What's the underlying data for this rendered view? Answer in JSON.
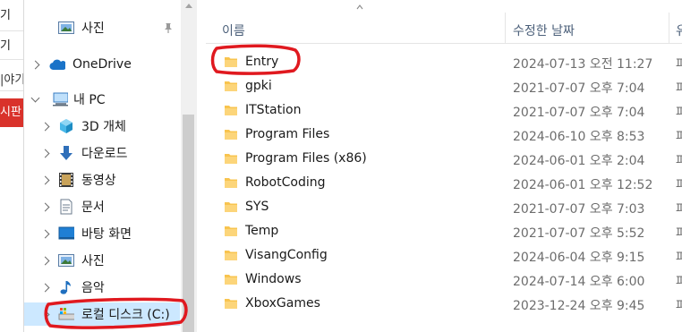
{
  "background_window": {
    "fragments": [
      "기",
      "기",
      "|야기"
    ],
    "red_bar_text": "시판"
  },
  "nav": {
    "items": [
      {
        "label": "사진",
        "icon": "pictures-icon",
        "pinned": true
      },
      {
        "label": "OneDrive",
        "icon": "onedrive-cloud-icon"
      },
      {
        "label": "내 PC",
        "icon": "this-pc-icon"
      },
      {
        "label": "3D 개체",
        "icon": "3d-objects-icon"
      },
      {
        "label": "다운로드",
        "icon": "downloads-icon"
      },
      {
        "label": "동영상",
        "icon": "videos-icon"
      },
      {
        "label": "문서",
        "icon": "documents-icon"
      },
      {
        "label": "바탕 화면",
        "icon": "desktop-icon"
      },
      {
        "label": "사진",
        "icon": "pictures-icon"
      },
      {
        "label": "음악",
        "icon": "music-icon"
      },
      {
        "label": "로컬 디스크 (C:)",
        "icon": "local-disk-icon",
        "selected": true
      }
    ]
  },
  "columns": {
    "name": "이름",
    "date": "수정한 날짜",
    "type": "유"
  },
  "files": [
    {
      "name": "Entry",
      "date": "2024-07-13 오전 11:27",
      "type": "파"
    },
    {
      "name": "gpki",
      "date": "2021-07-07 오후 7:04",
      "type": "파"
    },
    {
      "name": "ITStation",
      "date": "2021-07-07 오후 7:04",
      "type": "파"
    },
    {
      "name": "Program Files",
      "date": "2024-06-10 오후 8:53",
      "type": "파"
    },
    {
      "name": "Program Files (x86)",
      "date": "2024-06-01 오후 2:04",
      "type": "파"
    },
    {
      "name": "RobotCoding",
      "date": "2024-06-01 오후 12:52",
      "type": "파"
    },
    {
      "name": "SYS",
      "date": "2021-07-07 오후 7:03",
      "type": "파"
    },
    {
      "name": "Temp",
      "date": "2021-07-07 오후 5:52",
      "type": "파"
    },
    {
      "name": "VisangConfig",
      "date": "2024-06-04 오후 9:15",
      "type": "파"
    },
    {
      "name": "Windows",
      "date": "2024-07-14 오후 6:00",
      "type": "파"
    },
    {
      "name": "XboxGames",
      "date": "2023-12-24 오후 9:45",
      "type": "파"
    }
  ],
  "colors": {
    "selection": "#cce8ff",
    "folder": "#f8c44f",
    "annotation": "#e0191f",
    "header_text": "#4c607a"
  }
}
